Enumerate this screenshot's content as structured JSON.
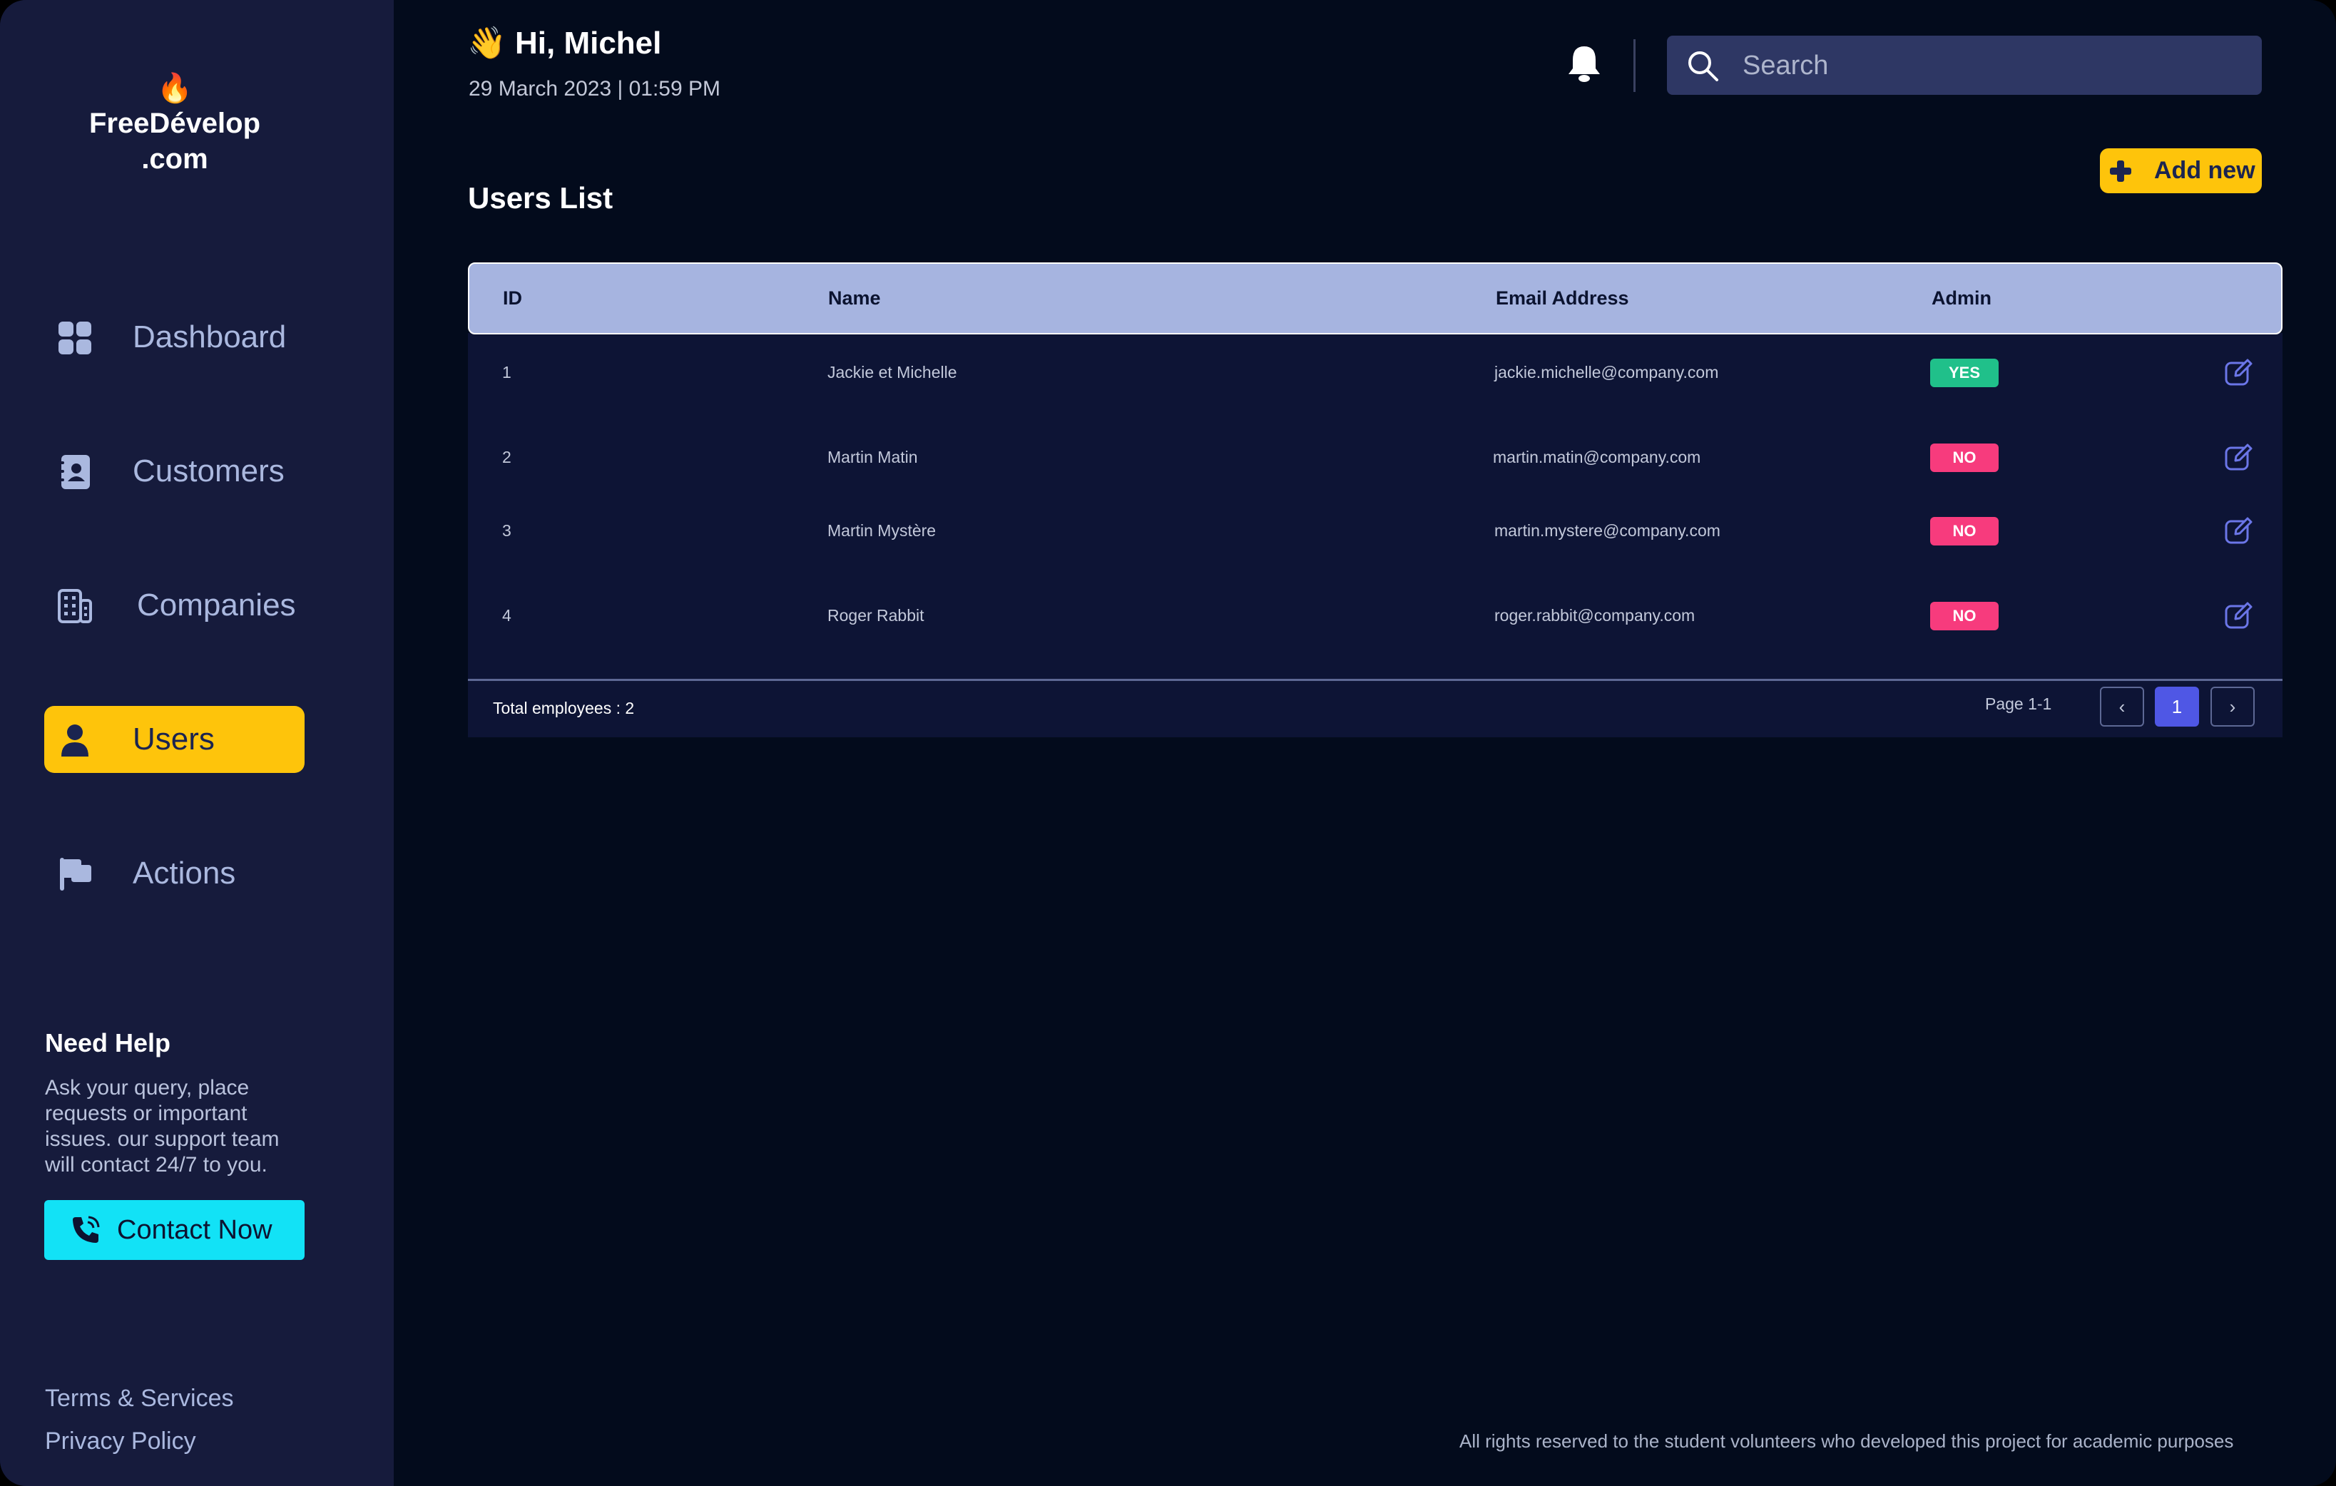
{
  "brand": {
    "flame": "🔥",
    "line1": "FreeDévelop",
    "line2": ".com"
  },
  "sidebar": {
    "items": [
      {
        "label": "Dashboard",
        "icon": "dashboard-icon",
        "active": false
      },
      {
        "label": "Customers",
        "icon": "contact-book-icon",
        "active": false
      },
      {
        "label": "Companies",
        "icon": "building-icon",
        "active": false
      },
      {
        "label": "Users",
        "icon": "user-icon",
        "active": true
      },
      {
        "label": "Actions",
        "icon": "flag-icon",
        "active": false
      }
    ],
    "help": {
      "title": "Need Help",
      "text": "Ask your query, place requests or important issues. our support team will contact 24/7 to you.",
      "button": "Contact Now"
    },
    "footer": {
      "terms": "Terms & Services",
      "privacy": "Privacy Policy"
    }
  },
  "header": {
    "greeting": "👋 Hi, Michel",
    "date": "29 March 2023 | 01:59 PM",
    "search_placeholder": "Search"
  },
  "main": {
    "title": "Users List",
    "add_button": "Add new",
    "table": {
      "columns": [
        "ID",
        "Name",
        "Email Address",
        "Admin"
      ],
      "rows": [
        {
          "id": "1",
          "name": "Jackie et Michelle",
          "email": "jackie.michelle@company.com",
          "admin": "YES"
        },
        {
          "id": "2",
          "name": "Martin Matin",
          "email": "martin.matin@company.com",
          "admin": "NO"
        },
        {
          "id": "3",
          "name": "Martin Mystère",
          "email": "martin.mystere@company.com",
          "admin": "NO"
        },
        {
          "id": "4",
          "name": "Roger Rabbit",
          "email": "roger.rabbit@company.com",
          "admin": "NO"
        }
      ]
    },
    "footer": {
      "total": "Total employees : 2",
      "page_info": "Page 1-1",
      "prev": "‹",
      "current_page": "1",
      "next": "›"
    }
  },
  "copyright": "All rights reserved to the student volunteers who developed this project for academic purposes",
  "colors": {
    "accent": "#fec40b",
    "contact": "#12e2f6",
    "yes": "#20c08a",
    "no": "#f73b7d",
    "page_active": "#4f57e5"
  }
}
